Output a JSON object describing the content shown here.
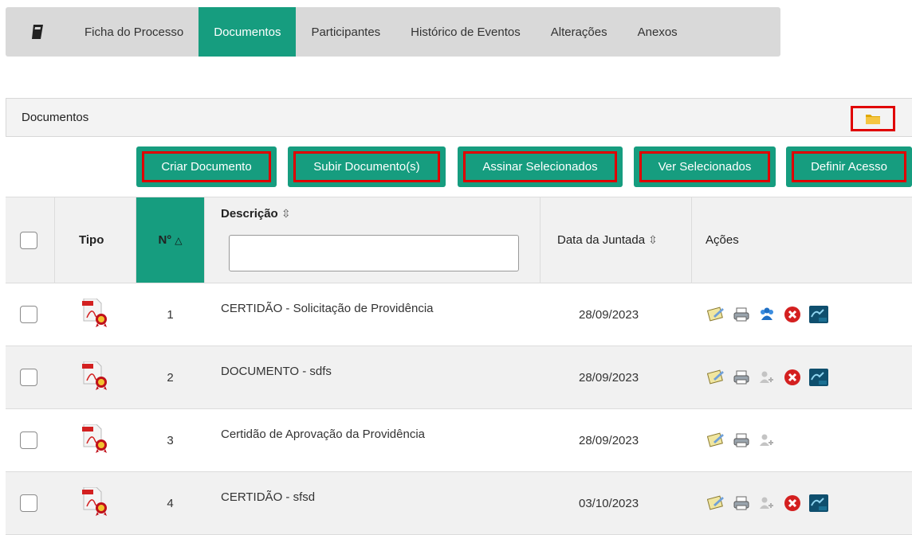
{
  "tabs": [
    {
      "label": "Ficha do Processo",
      "active": false
    },
    {
      "label": "Documentos",
      "active": true
    },
    {
      "label": "Participantes",
      "active": false
    },
    {
      "label": "Histórico de Eventos",
      "active": false
    },
    {
      "label": "Alterações",
      "active": false
    },
    {
      "label": "Anexos",
      "active": false
    }
  ],
  "section": {
    "title": "Documentos",
    "folder_icon": "folder-icon"
  },
  "buttons": {
    "create": "Criar Documento",
    "upload": "Subir Documento(s)",
    "sign": "Assinar Selecionados",
    "view": "Ver Selecionados",
    "access": "Definir Acesso"
  },
  "table": {
    "headers": {
      "tipo": "Tipo",
      "numero": "N°",
      "numero_sort": "△",
      "descricao": "Descrição",
      "descricao_sort": "⇳",
      "data": "Data da Juntada",
      "data_sort": "⇳",
      "acoes": "Ações"
    },
    "rows": [
      {
        "n": "1",
        "descricao": "CERTIDÃO - Solicitação de Providência",
        "data": "28/09/2023",
        "actions": [
          "edit-icon",
          "print-icon",
          "participants-icon",
          "delete-icon",
          "sign-icon"
        ]
      },
      {
        "n": "2",
        "descricao": "DOCUMENTO - sdfs",
        "data": "28/09/2023",
        "actions": [
          "edit-icon",
          "print-icon",
          "add-user-icon",
          "delete-icon",
          "sign-icon"
        ]
      },
      {
        "n": "3",
        "descricao": "Certidão de Aprovação da Providência",
        "data": "28/09/2023",
        "actions": [
          "edit-icon",
          "print-icon",
          "add-user-icon"
        ]
      },
      {
        "n": "4",
        "descricao": "CERTIDÃO - sfsd",
        "data": "03/10/2023",
        "actions": [
          "edit-icon",
          "print-icon",
          "add-user-icon",
          "delete-icon",
          "sign-icon"
        ]
      }
    ]
  },
  "colors": {
    "accent": "#169d7f",
    "highlight": "#e00000"
  }
}
